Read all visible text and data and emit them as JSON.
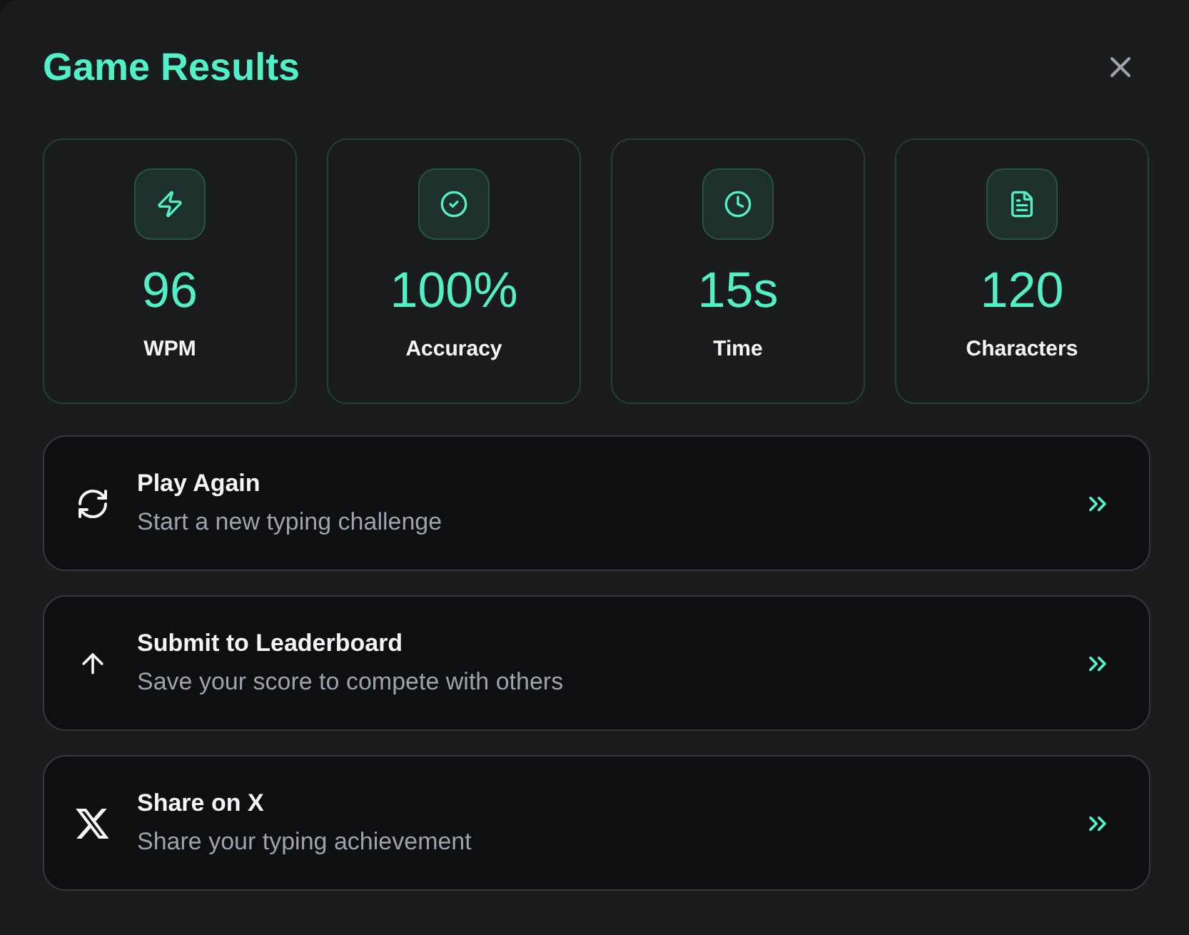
{
  "dialog": {
    "title": "Game Results"
  },
  "stats": [
    {
      "kind": "speed",
      "value": "96",
      "label": "WPM"
    },
    {
      "kind": "accuracy",
      "value": "100%",
      "label": "Accuracy"
    },
    {
      "kind": "time",
      "value": "15s",
      "label": "Time"
    },
    {
      "kind": "characters",
      "value": "120",
      "label": "Characters"
    }
  ],
  "actions": [
    {
      "kind": "replay",
      "title": "Play Again",
      "subtitle": "Start a new typing challenge"
    },
    {
      "kind": "submit",
      "title": "Submit to Leaderboard",
      "subtitle": "Save your score to compete with others"
    },
    {
      "kind": "share",
      "title": "Share on X",
      "subtitle": "Share your typing achievement"
    }
  ]
}
